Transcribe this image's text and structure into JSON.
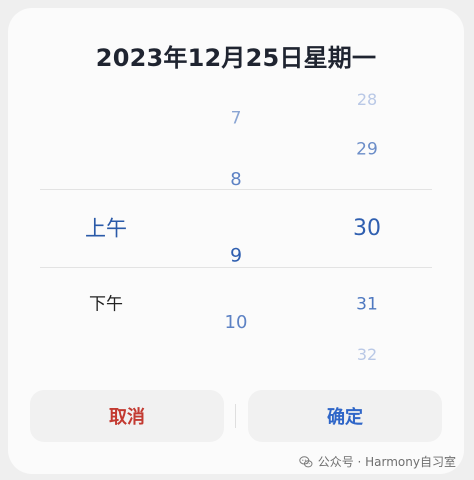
{
  "dialog": {
    "title": "2023年12月25日星期一"
  },
  "picker": {
    "ampm": {
      "items": [
        "上午",
        "下午"
      ]
    },
    "hours": {
      "items": [
        "7",
        "8",
        "9",
        "10"
      ]
    },
    "minutes": {
      "items": [
        "28",
        "29",
        "30",
        "31",
        "32"
      ]
    }
  },
  "actions": {
    "cancel_label": "取消",
    "confirm_label": "确定"
  },
  "watermark": {
    "text": "公众号 · Harmony自习室",
    "icon": "chat-icon"
  },
  "colors": {
    "title": "#1f2430",
    "selected": "#2f5fb0",
    "cancel": "#c33a31",
    "confirm": "#2f66c8",
    "button_bg": "#f1f1f1"
  }
}
